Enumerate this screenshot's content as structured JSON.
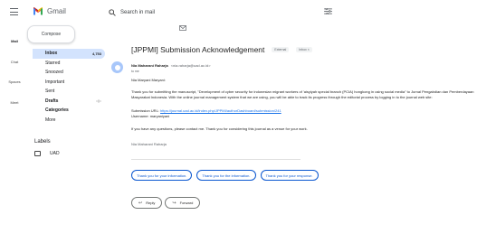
{
  "header": {
    "app_name": "Gmail",
    "search_placeholder": "Search in mail"
  },
  "rail": {
    "items": [
      "Mail",
      "Chat",
      "Spaces",
      "Meet"
    ]
  },
  "sidebar": {
    "compose_label": "Compose",
    "items": [
      {
        "label": "Inbox",
        "count": "4,753"
      },
      {
        "label": "Starred",
        "count": ""
      },
      {
        "label": "Snoozed",
        "count": ""
      },
      {
        "label": "Important",
        "count": ""
      },
      {
        "label": "Sent",
        "count": ""
      },
      {
        "label": "Drafts",
        "count": ""
      },
      {
        "label": "Categories",
        "count": ""
      },
      {
        "label": "More",
        "count": ""
      }
    ],
    "labels_heading": "Labels",
    "label_items": [
      "UAD"
    ]
  },
  "message": {
    "subject": "[JPPMI] Submission Acknowledgement",
    "badge_external": "External",
    "badge_inbox": "Inbox",
    "sender_name": "Nia Maharani Raharja",
    "sender_email": "<nia.raharja@uad.ac.id>",
    "to_me": "to me",
    "greeting": "Nia Maryani Maryani:",
    "paragraph1": "Thank you for submitting the manuscript, \"Development of cyber security for indonesian migrant workers of 'aisyiyah special branch (PCIA) hongkong in using social media\" to Jurnal Pengabdian dan Pemberdayaan Masyarakat Indonesia. With the online journal management system that we are using, you will be able to track its progress through the editorial process by logging in to the journal web site:",
    "url_label": "Submission URL:",
    "url": "https://journal.uad.ac.id/index.php/JPPMI/authorDashboard/submission/241",
    "username_label": "Username:",
    "username": "maryaniyani",
    "paragraph2": "If you have any questions, please contact me. Thank you for considering this journal as a venue for your work.",
    "signature": "Nia Maharani Raharja"
  },
  "smart_replies": [
    "Thank you for your information.",
    "Thank you for the information.",
    "Thank you for your response."
  ],
  "actions": {
    "reply": "Reply",
    "forward": "Forward"
  },
  "colors": {
    "accent": "#0b57d0",
    "active_nav": "#d3e3fd",
    "link": "#1a73e8"
  }
}
